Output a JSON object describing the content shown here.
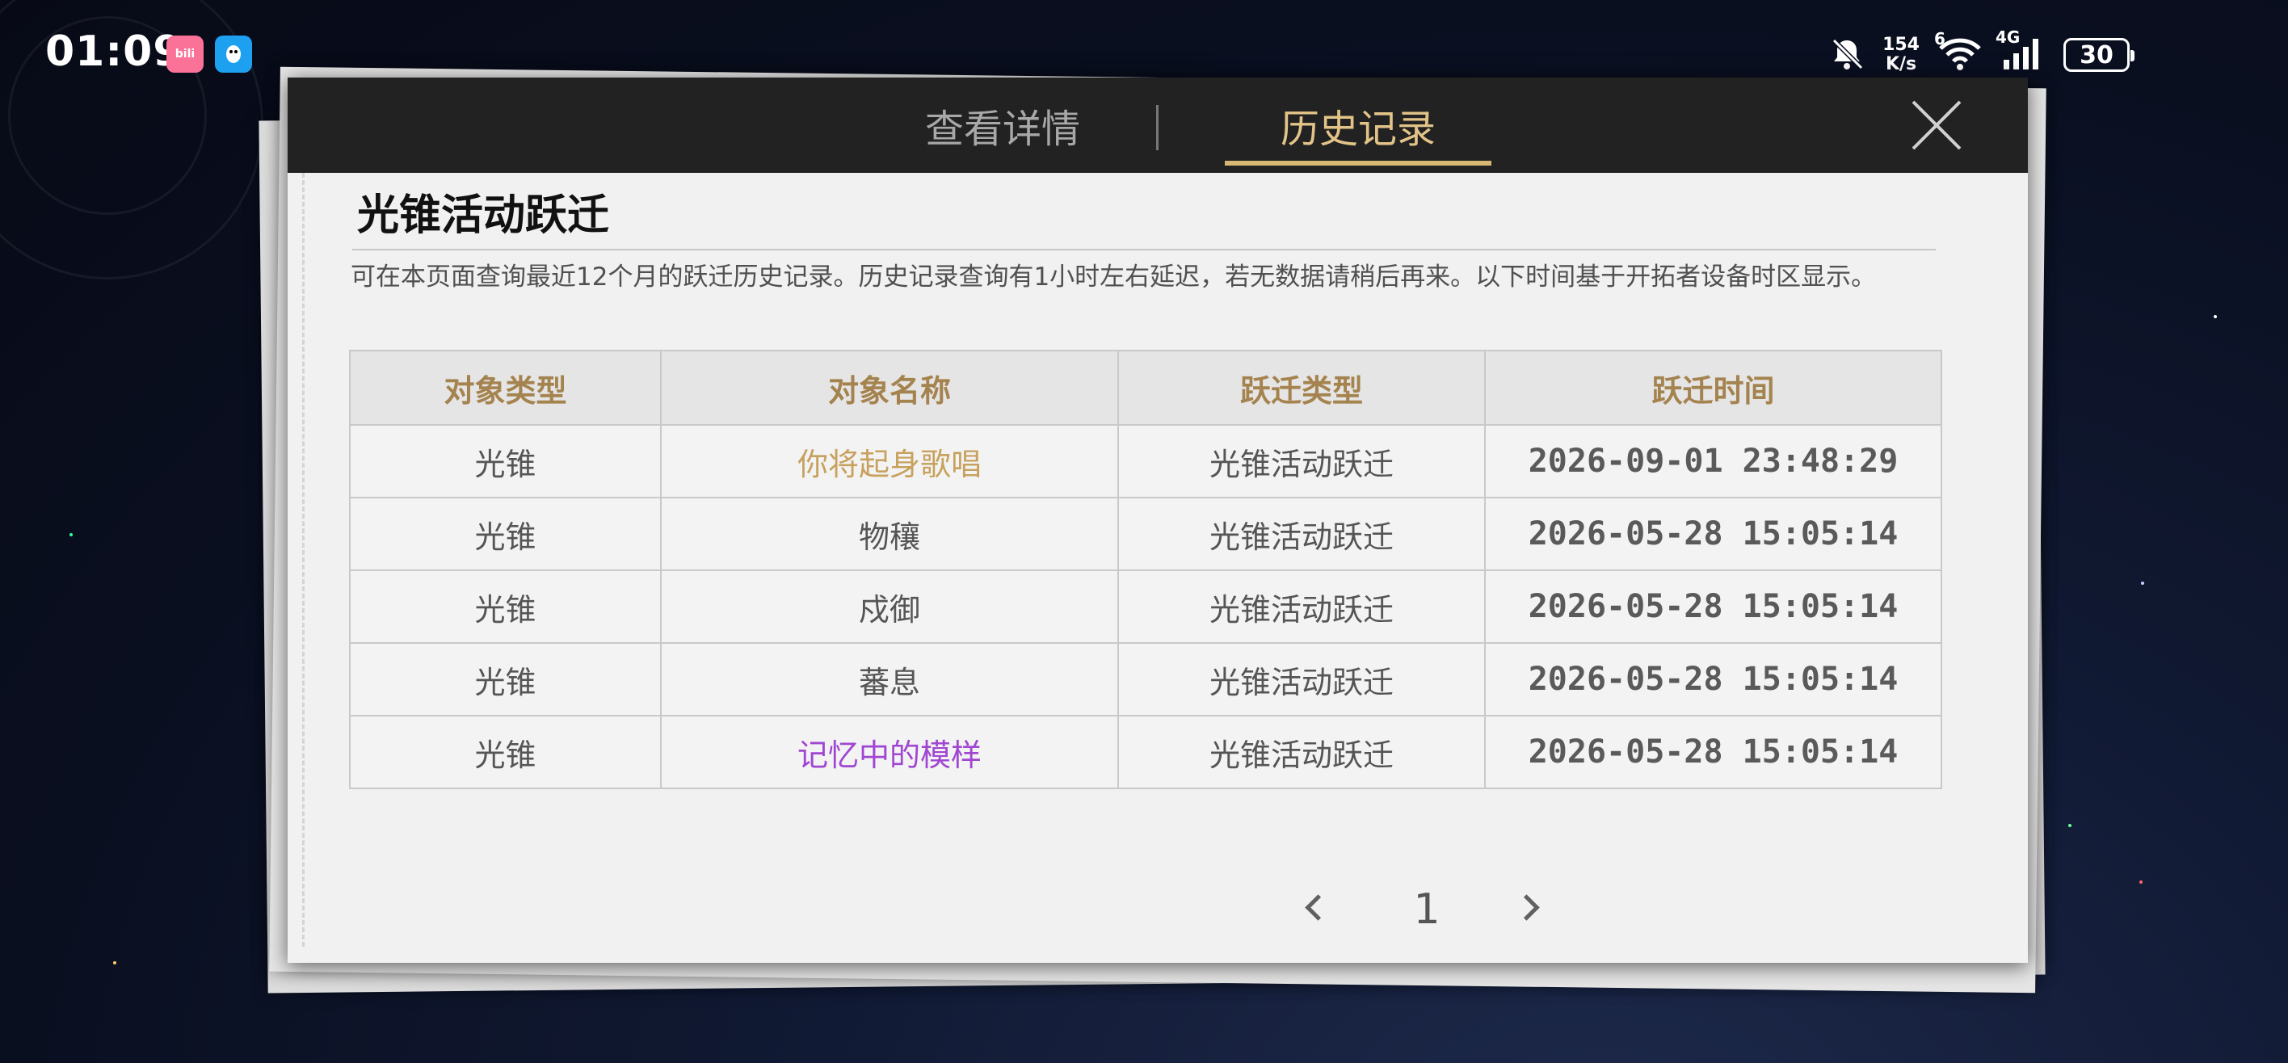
{
  "status_bar": {
    "time": "01:09",
    "net_speed_value": "154",
    "net_speed_unit": "K/s",
    "signal_6g": "6",
    "signal_4g": "4G",
    "battery": "30"
  },
  "modal": {
    "tabs": [
      {
        "label": "查看详情",
        "active": false
      },
      {
        "label": "历史记录",
        "active": true
      }
    ],
    "section_title": "光锥活动跃迁",
    "notice": "可在本页面查询最近12个月的跃迁历史记录。历史记录查询有1小时左右延迟，若无数据请稍后再来。以下时间基于开拓者设备时区显示。",
    "table": {
      "headers": [
        "对象类型",
        "对象名称",
        "跃迁类型",
        "跃迁时间"
      ],
      "rows": [
        {
          "type": "光锥",
          "name": "你将起身歌唱",
          "warp": "光锥活动跃迁",
          "time": "2026-09-01 23:48:29",
          "rarity": "gold"
        },
        {
          "type": "光锥",
          "name": "物穰",
          "warp": "光锥活动跃迁",
          "time": "2026-05-28 15:05:14",
          "rarity": "normal"
        },
        {
          "type": "光锥",
          "name": "戍御",
          "warp": "光锥活动跃迁",
          "time": "2026-05-28 15:05:14",
          "rarity": "normal"
        },
        {
          "type": "光锥",
          "name": "蕃息",
          "warp": "光锥活动跃迁",
          "time": "2026-05-28 15:05:14",
          "rarity": "normal"
        },
        {
          "type": "光锥",
          "name": "记忆中的模样",
          "warp": "光锥活动跃迁",
          "time": "2026-05-28 15:05:14",
          "rarity": "purple"
        }
      ]
    },
    "pagination": {
      "current_page": "1"
    }
  },
  "colors": {
    "accent_gold": "#d8b674",
    "header_text": "#a4834f",
    "rarity_gold": "#c7a15d",
    "rarity_purple": "#a046d2"
  },
  "icons": {
    "close": "close-icon",
    "prev": "chevron-left-icon",
    "next": "chevron-right-icon",
    "wifi": "wifi-icon",
    "signal": "signal-icon",
    "mute": "bell-off-icon",
    "battery": "battery-icon"
  }
}
